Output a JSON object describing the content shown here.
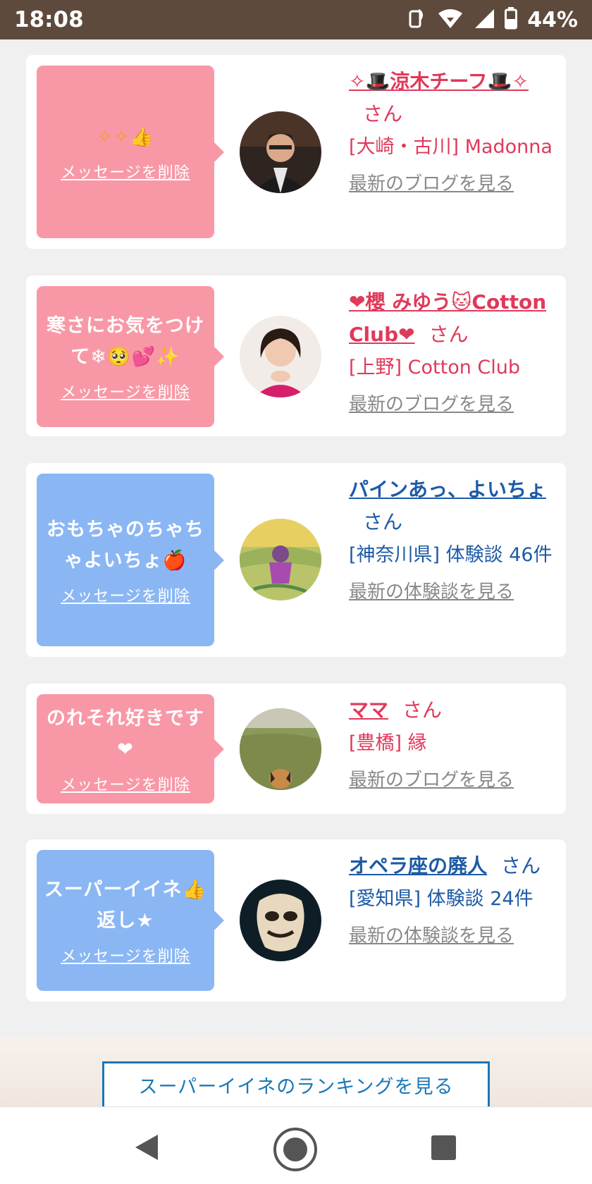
{
  "status_bar": {
    "time": "18:08",
    "battery": "44%"
  },
  "cards": [
    {
      "theme": "pink",
      "message": "✧✧👍",
      "delete_label": "メッセージを削除",
      "name": "✧🎩涼木チーフ🎩✧",
      "san": "さん",
      "shop": "[大崎・古川] Madonna",
      "link": "最新のブログを見る"
    },
    {
      "theme": "pink",
      "message": "寒さにお気をつけて❄🥺💕✨",
      "delete_label": "メッセージを削除",
      "name": "❤櫻 みゆう🐱Cotton Club❤",
      "san": "さん",
      "shop": "[上野] Cotton Club",
      "link": "最新のブログを見る"
    },
    {
      "theme": "blue",
      "message": "おもちゃのちゃちゃよいちょ🍎",
      "delete_label": "メッセージを削除",
      "name": "パインあっ、よいちょ",
      "san": "さん",
      "shop": "[神奈川県] 体験談 46件",
      "link": "最新の体験談を見る"
    },
    {
      "theme": "pink",
      "message": "のれそれ好きです❤",
      "delete_label": "メッセージを削除",
      "name": "ママ",
      "san": "さん",
      "shop": "[豊橋] 縁",
      "link": "最新のブログを見る"
    },
    {
      "theme": "blue",
      "message": "スーパーイイネ👍返し★",
      "delete_label": "メッセージを削除",
      "name": "オペラ座の廃人",
      "san": "さん",
      "shop": "[愛知県] 体験談 24件",
      "link": "最新の体験談を見る"
    }
  ],
  "ranking_button": "スーパーイイネのランキングを見る",
  "colors": {
    "status_bar": "#5d4a3c",
    "pink_bubble": "#f898a6",
    "blue_bubble": "#8ab7f4",
    "pink_text": "#e0395a",
    "blue_text": "#1d5aa6",
    "ranking_border": "#1b77b8"
  },
  "icons": {
    "status": [
      "nfc-icon",
      "wifi-icon",
      "signal-icon",
      "battery-icon"
    ],
    "nav": [
      "back-icon",
      "home-icon",
      "recents-icon"
    ]
  }
}
